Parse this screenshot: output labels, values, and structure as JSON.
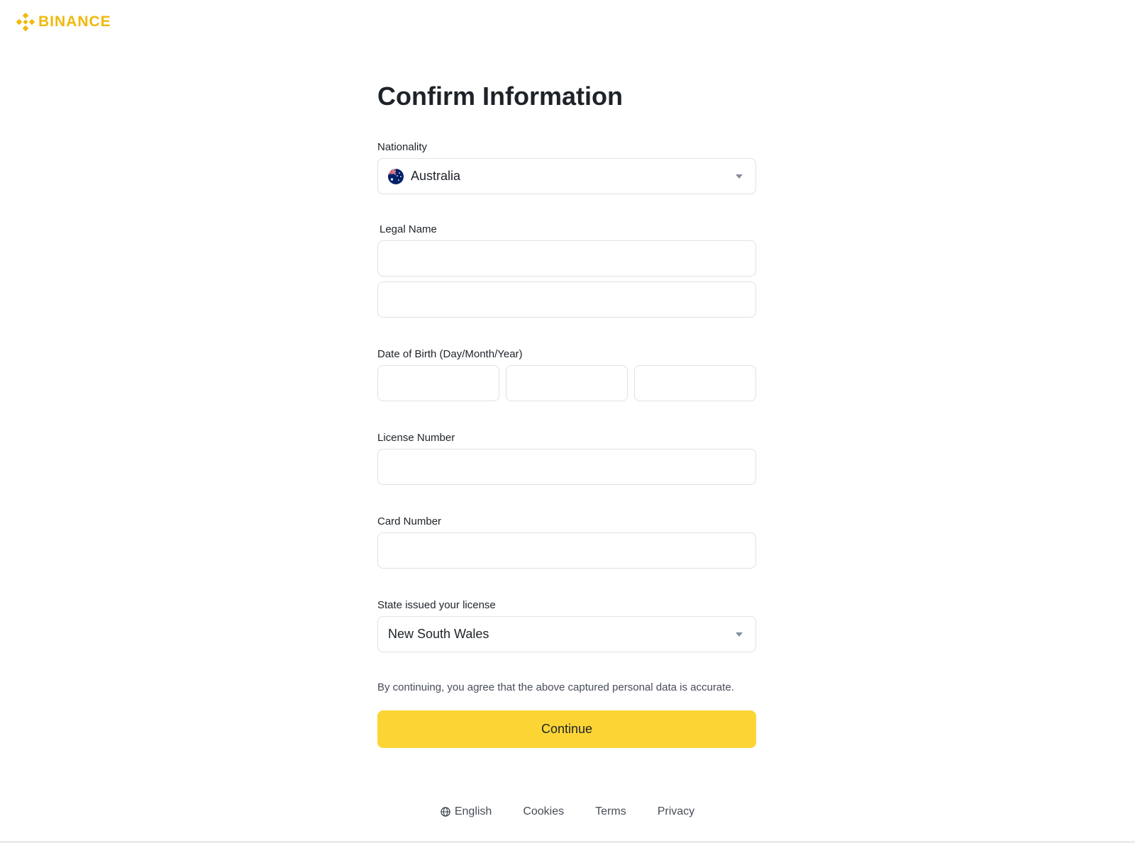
{
  "brand": {
    "name": "BINANCE",
    "color": "#F0B90B"
  },
  "form": {
    "title": "Confirm Information",
    "nationality": {
      "label": "Nationality",
      "value": "Australia",
      "flag_icon": "australia-flag-icon"
    },
    "legal_name": {
      "label": "Legal Name",
      "value_1": "",
      "value_2": ""
    },
    "dob": {
      "label": "Date of Birth (Day/Month/Year)",
      "day": "",
      "month": "",
      "year": ""
    },
    "license_number": {
      "label": "License Number",
      "value": ""
    },
    "card_number": {
      "label": "Card Number",
      "value": ""
    },
    "state": {
      "label": "State issued your license",
      "value": "New South Wales"
    },
    "disclaimer": "By continuing, you agree that the above captured personal data is accurate.",
    "continue_label": "Continue",
    "accent": "#FCD535"
  },
  "footer": {
    "language": "English",
    "language_icon": "globe-icon",
    "links": [
      "Cookies",
      "Terms",
      "Privacy"
    ]
  }
}
